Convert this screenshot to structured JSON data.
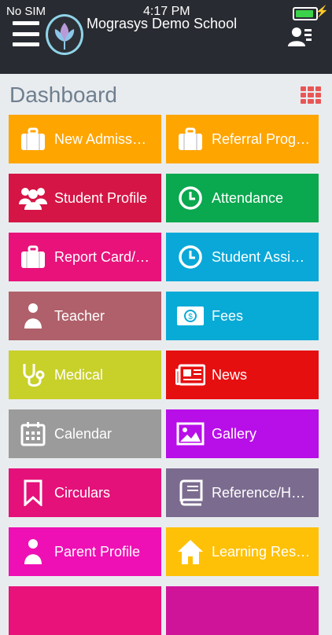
{
  "status_bar": {
    "carrier": "No SIM",
    "time": "4:17 PM",
    "battery_level": 0.9
  },
  "header": {
    "title": "Mograsys Demo School"
  },
  "dashboard": {
    "title": "Dashboard"
  },
  "tiles": [
    {
      "label": "New Admiss…",
      "icon": "briefcase-icon",
      "color": "#ffa500"
    },
    {
      "label": "Referral Prog…",
      "icon": "briefcase-icon",
      "color": "#ffa500"
    },
    {
      "label": "Student Profile",
      "icon": "group-icon",
      "color": "#d51545"
    },
    {
      "label": "Attendance",
      "icon": "clock-icon",
      "color": "#0aa84f"
    },
    {
      "label": "Report Card/…",
      "icon": "briefcase-icon",
      "color": "#e8127a"
    },
    {
      "label": "Student Assi…",
      "icon": "clock-icon",
      "color": "#0aa8d8"
    },
    {
      "label": "Teacher",
      "icon": "person-icon",
      "color": "#b0606a"
    },
    {
      "label": "Fees",
      "icon": "banknote-icon",
      "color": "#08aad6"
    },
    {
      "label": "Medical",
      "icon": "stethoscope-icon",
      "color": "#c8d02a"
    },
    {
      "label": "News",
      "icon": "newspaper-icon",
      "color": "#e60f10"
    },
    {
      "label": "Calendar",
      "icon": "calendar-icon",
      "color": "#9b9b9b"
    },
    {
      "label": "Gallery",
      "icon": "image-icon",
      "color": "#b80ee8"
    },
    {
      "label": "Circulars",
      "icon": "bookmark-icon",
      "color": "#e4117a"
    },
    {
      "label": "Reference/H…",
      "icon": "book-icon",
      "color": "#7b6b8f"
    },
    {
      "label": "Parent Profile",
      "icon": "person-icon",
      "color": "#ee10b4"
    },
    {
      "label": "Learning Res…",
      "icon": "home-icon",
      "color": "#ffc107"
    }
  ]
}
